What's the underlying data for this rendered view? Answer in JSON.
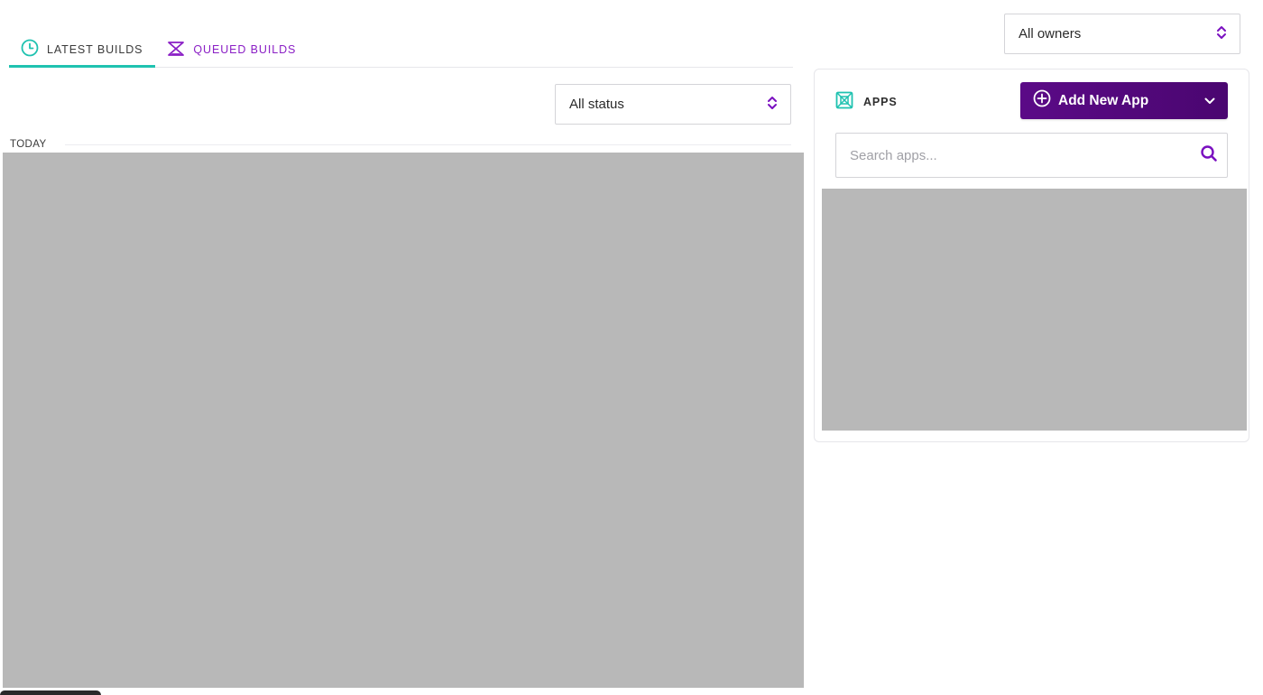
{
  "filters": {
    "owners": {
      "selected": "All owners"
    },
    "status": {
      "selected": "All status"
    }
  },
  "tabs": [
    {
      "label": "LATEST BUILDS",
      "icon": "clock-icon",
      "active": true
    },
    {
      "label": "QUEUED BUILDS",
      "icon": "hourglass-icon",
      "active": false
    }
  ],
  "builds": {
    "group_label": "TODAY"
  },
  "apps": {
    "title": "APPS",
    "icon": "apps-box-icon",
    "add_button_label": "Add New App",
    "search_placeholder": "Search apps..."
  },
  "colors": {
    "accent_teal": "#1fc2b0",
    "accent_purple": "#8a1ec5",
    "button_purple": "#5b0a87"
  }
}
